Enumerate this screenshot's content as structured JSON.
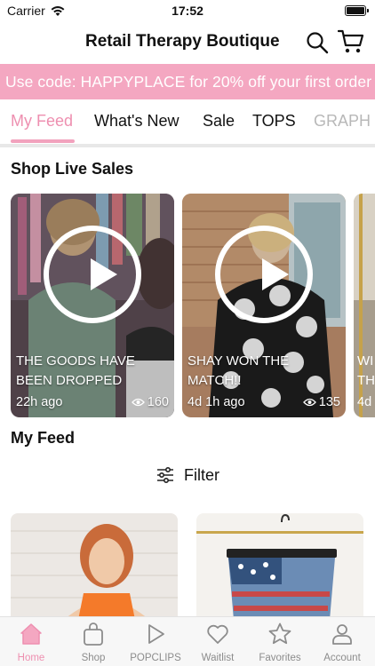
{
  "status_bar": {
    "carrier": "Carrier",
    "time": "17:52"
  },
  "header": {
    "title": "Retail Therapy Boutique"
  },
  "promo": {
    "text": "Use code: HAPPYPLACE for 20% off your first order"
  },
  "tabs": [
    {
      "label": "My Feed",
      "active": true
    },
    {
      "label": "What's New"
    },
    {
      "label": "Sale"
    },
    {
      "label": "TOPS"
    },
    {
      "label": "GRAPH"
    }
  ],
  "live_section": {
    "title": "Shop Live Sales",
    "cards": [
      {
        "title": "THE GOODS HAVE BEEN DROPPED",
        "time": "22h ago",
        "views": "160"
      },
      {
        "title": "SHAY WON THE MATCH!!",
        "time": "4d 1h ago",
        "views": "135"
      },
      {
        "title_fragment": "WI\nTH",
        "time_fragment": "4d"
      }
    ]
  },
  "feed": {
    "title": "My Feed",
    "filter_label": "Filter"
  },
  "bottom_nav": [
    {
      "label": "Home",
      "icon": "home-icon",
      "active": true
    },
    {
      "label": "Shop",
      "icon": "bag-icon"
    },
    {
      "label": "POPCLIPS",
      "icon": "play-icon"
    },
    {
      "label": "Waitlist",
      "icon": "heart-icon"
    },
    {
      "label": "Favorites",
      "icon": "star-icon"
    },
    {
      "label": "Account",
      "icon": "person-icon"
    }
  ],
  "colors": {
    "accent": "#f4a7c1",
    "active_tab": "#ee8fb0",
    "inactive_nav": "#8c8c8c"
  }
}
